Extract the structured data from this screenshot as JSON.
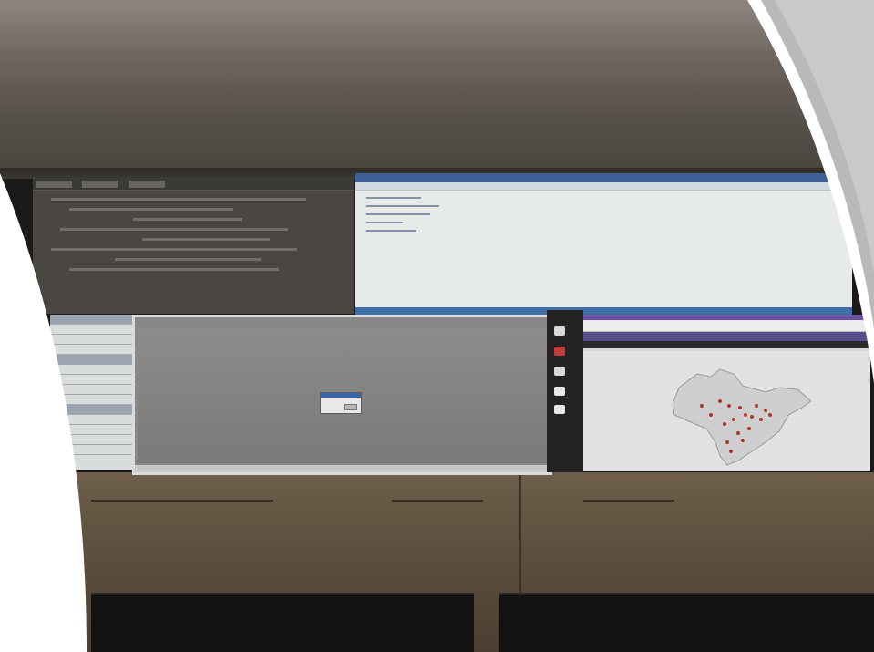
{
  "scene": {
    "description_visible_text": "",
    "panels": [
      {
        "name": "terminal-panel",
        "theme": "dark"
      },
      {
        "name": "editor-panel",
        "theme": "light"
      },
      {
        "name": "spreadsheet-panel",
        "theme": "light"
      },
      {
        "name": "dialog-panel",
        "theme": "gray"
      },
      {
        "name": "map-browser-panel",
        "theme": "light"
      }
    ],
    "colors": {
      "editor_titlebar": "#3f5f97",
      "browser_tabbar": "#6b4fa0",
      "map_point": "#b2382b",
      "dialog_gray": "#8a8886"
    }
  }
}
